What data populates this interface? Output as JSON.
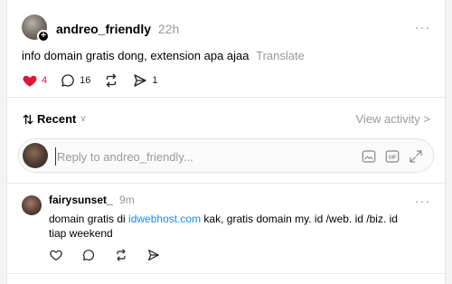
{
  "post": {
    "username": "andreo_friendly",
    "time": "22h",
    "text": "info domain gratis dong, extension apa ajaa",
    "translate": "Translate",
    "likes": "4",
    "comments": "16",
    "shares": "1",
    "more": "···"
  },
  "sort": {
    "label": "Recent",
    "view_activity": "View activity >"
  },
  "reply": {
    "placeholder": "Reply to andreo_friendly..."
  },
  "comment": {
    "username": "fairysunset_",
    "time": "9m",
    "text_before": "domain gratis di ",
    "link": "idwebhost.com",
    "text_after": " kak, gratis domain my. id /web. id /biz. id tiap weekend",
    "more": "···"
  },
  "colors": {
    "like": "#d81b3b",
    "link": "#1e88e5"
  }
}
